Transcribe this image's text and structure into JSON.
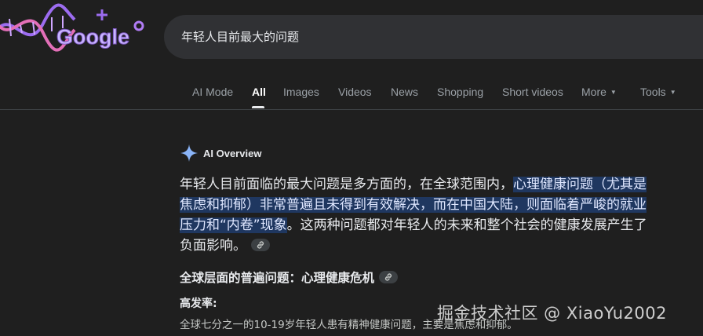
{
  "logo": {
    "text": "Google"
  },
  "search": {
    "query": "年轻人目前最大的问题"
  },
  "tabs": [
    {
      "label": "AI Mode"
    },
    {
      "label": "All",
      "active": true
    },
    {
      "label": "Images"
    },
    {
      "label": "Videos"
    },
    {
      "label": "News"
    },
    {
      "label": "Shopping"
    },
    {
      "label": "Short videos"
    },
    {
      "label": "More"
    },
    {
      "label": "Tools"
    }
  ],
  "ai_overview": {
    "title": "AI Overview",
    "p1": "年轻人目前面临的最大问题是多方面的，在全球范围内，",
    "p2_highlight_a": "心理健康问题（尤其是",
    "p2_highlight_b": "焦虑和抑郁）非常普遍且未得到有效解决，而在中国大陆，则面临着严峻的就业",
    "p2_highlight_c": "压力和“内卷”现象",
    "p3": "。这两种问题都对年轻人的未来和整个社会的健康发展产生了",
    "p4": "负面影响。",
    "section_title": "全球层面的普遍问题：心理健康危机",
    "rate_label": "高发率:",
    "rate_text": "全球七分之一的10-19岁年轻人患有精神健康问题，主要是焦虑和抑郁。"
  },
  "watermark": "掘金技术社区 @ XiaoYu2002",
  "colors": {
    "background": "#1f1f1f",
    "search_box": "#303134",
    "highlight": "#1f3760",
    "spark_blue": "#8ab4f8"
  }
}
